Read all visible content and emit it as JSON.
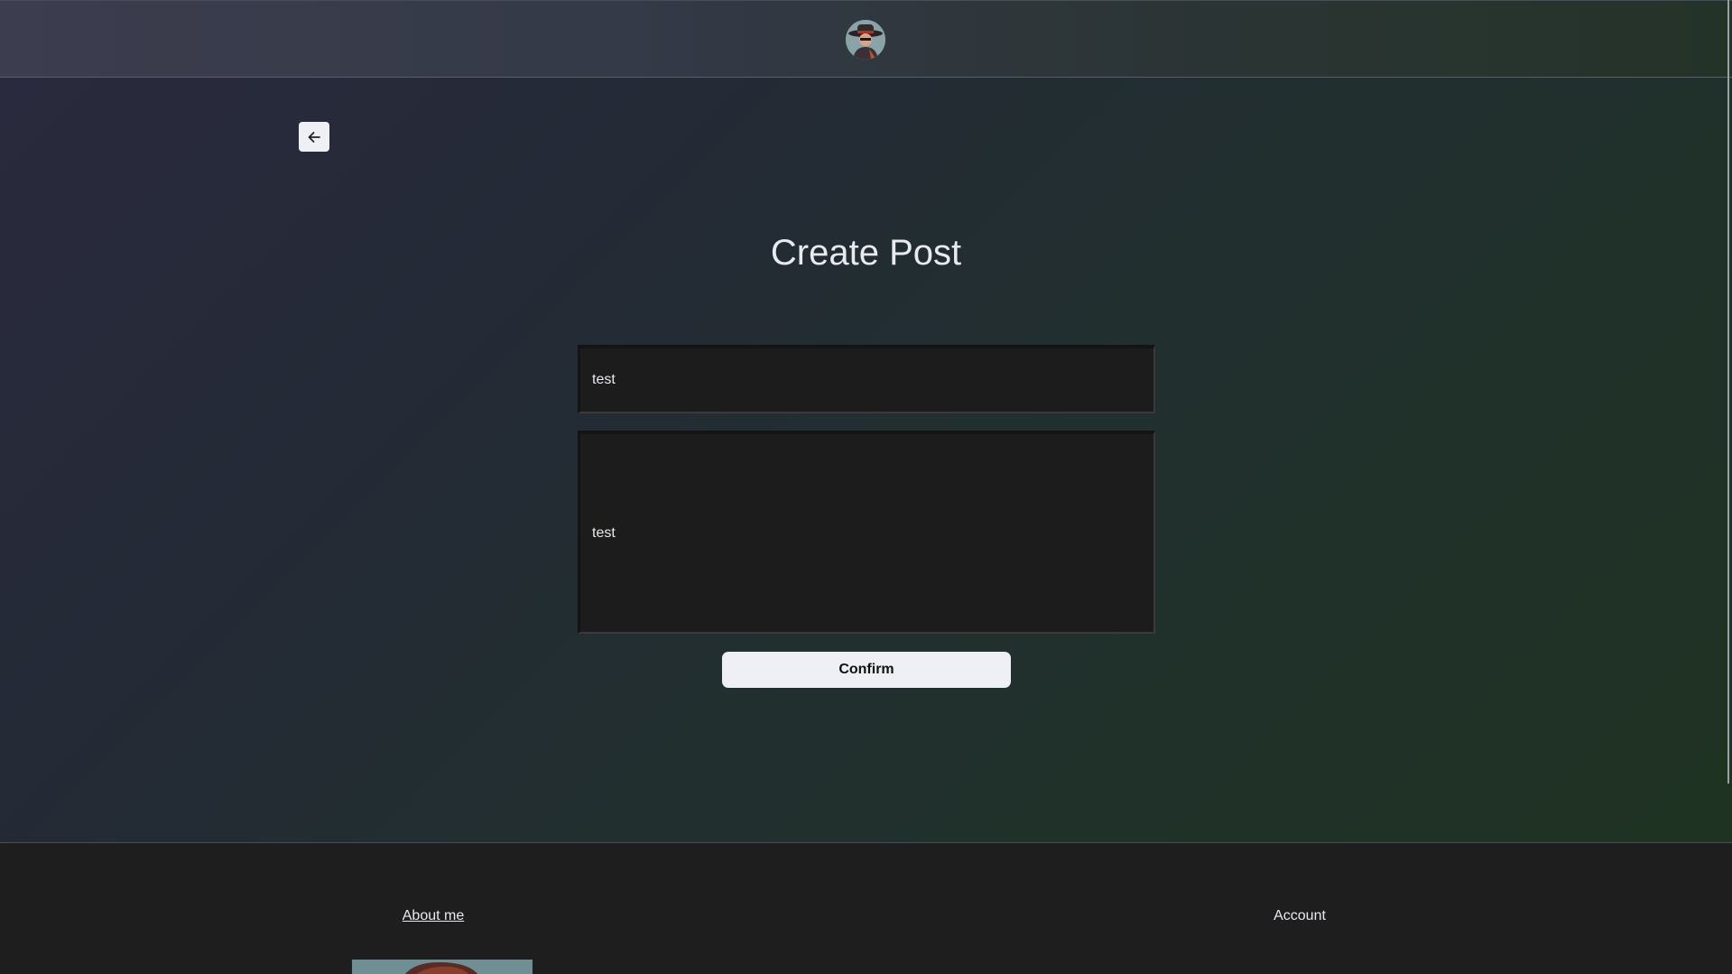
{
  "page": {
    "title": "Create Post"
  },
  "header": {
    "avatar_icon": "user-avatar-icon"
  },
  "navigation": {
    "back_icon": "arrow-left-icon"
  },
  "form": {
    "title_value": "test",
    "body_value": "test",
    "confirm_label": "Confirm"
  },
  "footer": {
    "about_label": "About me",
    "account_label": "Account"
  },
  "colors": {
    "button_bg": "#eef0f6",
    "input_bg": "#1c1c1c",
    "footer_bg": "#1e1e1e"
  }
}
